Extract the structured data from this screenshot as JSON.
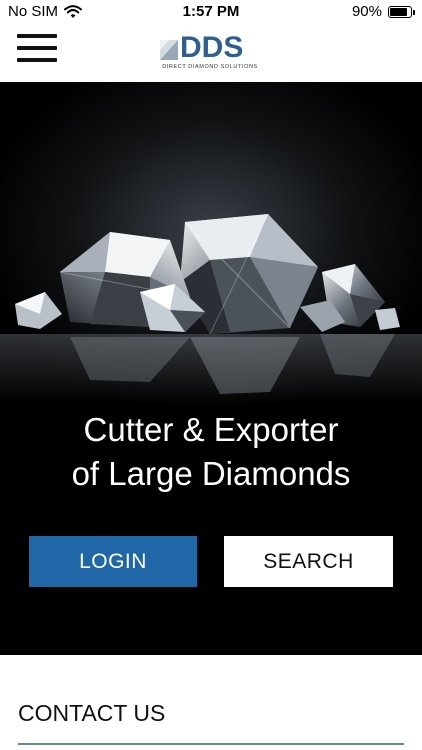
{
  "status_bar": {
    "carrier": "No SIM",
    "time": "1:57 PM",
    "battery": "90%",
    "battery_level": 0.9
  },
  "header": {
    "logo_text": "DDS",
    "logo_subtitle": "DIRECT DIAMOND SOLUTIONS"
  },
  "hero": {
    "title_line1": "Cutter & Exporter",
    "title_line2": "of Large Diamonds",
    "login_label": "LOGIN",
    "search_label": "SEARCH"
  },
  "contact": {
    "title": "CONTACT US"
  },
  "colors": {
    "accent": "#1f67a6",
    "logo": "#2f5f8f",
    "hero_bg": "#000000"
  }
}
